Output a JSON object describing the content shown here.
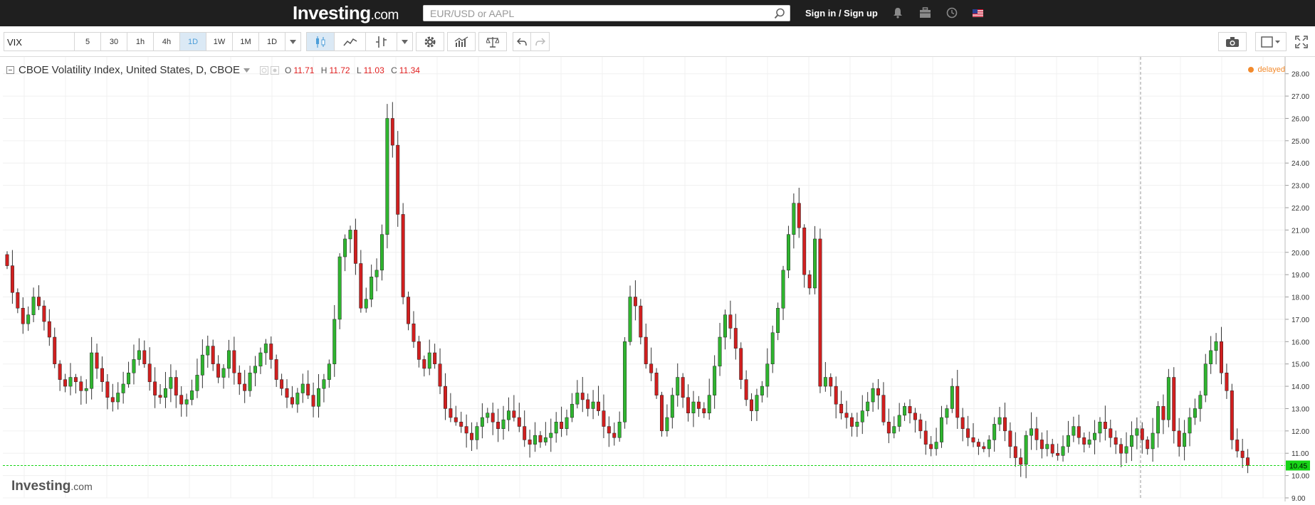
{
  "header": {
    "logo_main": "Investing",
    "logo_suffix": ".com",
    "search_placeholder": "EUR/USD or AAPL",
    "signin_label": "Sign in / Sign up",
    "icons": [
      "bell-icon",
      "briefcase-icon",
      "clock-icon",
      "us-flag-icon"
    ]
  },
  "toolbar": {
    "symbol": "VIX",
    "timeframes": [
      "5",
      "30",
      "1h",
      "4h",
      "1D",
      "1W",
      "1M",
      "1D"
    ],
    "active_timeframe": "1D",
    "icons": [
      "candles-icon",
      "line-chart-icon",
      "chart-type-icon",
      "dropdown-icon",
      "settings-icon",
      "indicators-icon",
      "compare-icon",
      "undo-icon",
      "redo-icon",
      "camera-icon",
      "layout-icon",
      "fullscreen-icon"
    ]
  },
  "legend": {
    "title": "CBOE Volatility Index, United States, D, CBOE",
    "o_label": "O",
    "o_value": "11.71",
    "h_label": "H",
    "h_value": "11.72",
    "l_label": "L",
    "l_value": "11.03",
    "c_label": "C",
    "c_value": "11.34"
  },
  "status": {
    "delayed": "delayed"
  },
  "watermark": {
    "main": "Investing",
    "suffix": ".com"
  },
  "colors": {
    "up": "#2fb52f",
    "down": "#d11f1f",
    "price_line": "#16d416",
    "grid": "#f0f0f0"
  },
  "chart_data": {
    "type": "candlestick",
    "last_price": 10.45,
    "last_price_label": "10.45",
    "ylim": [
      9.0,
      28.5
    ],
    "yticks": [
      9,
      10,
      11,
      12,
      13,
      14,
      15,
      16,
      17,
      18,
      19,
      20,
      21,
      22,
      23,
      24,
      25,
      26,
      27,
      28
    ],
    "ytick_labels": [
      "9.00",
      "10.00",
      "11.00",
      "12.00",
      "13.00",
      "14.00",
      "15.00",
      "16.00",
      "17.00",
      "18.00",
      "19.00",
      "20.00",
      "21.00",
      "22.00",
      "23.00",
      "24.00",
      "25.00",
      "26.00",
      "27.00",
      "28.00"
    ],
    "close_path": [
      19.4,
      18.2,
      17.5,
      16.8,
      17.2,
      18.0,
      17.6,
      16.9,
      16.2,
      15.0,
      14.3,
      14.0,
      14.4,
      14.2,
      13.8,
      13.9,
      15.5,
      14.8,
      14.2,
      13.5,
      13.3,
      13.7,
      14.1,
      14.6,
      15.2,
      15.6,
      15.0,
      14.2,
      13.6,
      13.5,
      13.9,
      14.4,
      13.6,
      13.2,
      13.4,
      13.8,
      14.5,
      15.4,
      15.8,
      15.0,
      14.4,
      14.8,
      15.6,
      14.6,
      14.1,
      13.8,
      14.6,
      14.9,
      15.5,
      15.9,
      15.2,
      14.3,
      13.9,
      13.5,
      13.2,
      13.7,
      14.1,
      13.6,
      13.1,
      13.9,
      14.3,
      15.0,
      17.0,
      19.8,
      20.6,
      21.0,
      19.5,
      17.5,
      17.9,
      18.9,
      19.2,
      20.8,
      26.0,
      24.8,
      21.7,
      18.0,
      16.8,
      16.0,
      15.2,
      14.8,
      15.5,
      15.0,
      14.0,
      13.0,
      12.6,
      12.4,
      12.2,
      11.9,
      11.6,
      12.2,
      12.6,
      12.8,
      12.4,
      12.1,
      12.5,
      12.9,
      12.6,
      12.2,
      11.6,
      11.4,
      11.8,
      11.5,
      11.7,
      11.9,
      12.4,
      12.1,
      12.6,
      13.2,
      13.7,
      13.4,
      13.0,
      13.3,
      12.9,
      12.2,
      11.9,
      11.7,
      12.4,
      16.0,
      18.0,
      17.6,
      16.2,
      15.0,
      14.6,
      13.6,
      12.0,
      12.6,
      13.6,
      14.4,
      13.5,
      12.8,
      13.3,
      13.0,
      12.8,
      13.6,
      14.9,
      16.2,
      17.2,
      16.6,
      15.7,
      14.3,
      13.4,
      12.9,
      13.6,
      14.0,
      15.0,
      16.4,
      17.5,
      19.2,
      20.8,
      22.2,
      21.1,
      19.0,
      18.4,
      20.6,
      14.0,
      14.4,
      14.0,
      13.2,
      12.8,
      12.6,
      12.2,
      12.4,
      12.9,
      13.3,
      13.9,
      13.6,
      12.4,
      11.9,
      12.2,
      12.7,
      13.1,
      12.8,
      12.5,
      12.0,
      11.4,
      11.2,
      11.5,
      12.6,
      13.0,
      14.0,
      12.6,
      12.1,
      11.7,
      11.5,
      11.3,
      11.2,
      11.6,
      12.3,
      12.6,
      12.0,
      11.3,
      10.8,
      10.5,
      11.8,
      12.1,
      11.6,
      11.2,
      11.4,
      11.0,
      10.9,
      11.3,
      11.8,
      12.2,
      11.7,
      11.4,
      11.6,
      11.9,
      12.4,
      12.1,
      11.7,
      11.4,
      11.0,
      11.3,
      11.8,
      12.1,
      11.6,
      11.2,
      11.9,
      13.1,
      12.5,
      14.4,
      12.0,
      11.3,
      11.9,
      12.6,
      13.0,
      13.6,
      15.0,
      15.6,
      16.0,
      14.6,
      13.8,
      11.6,
      11.1,
      10.8,
      10.45
    ]
  }
}
